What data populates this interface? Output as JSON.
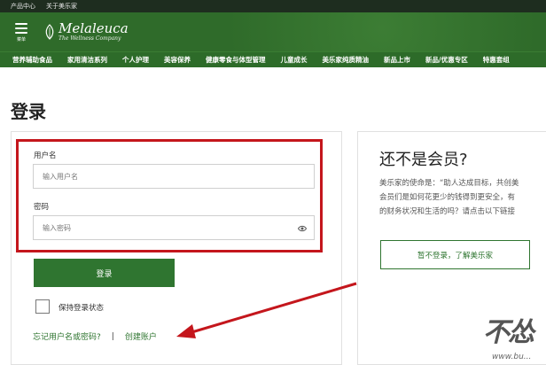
{
  "topbar": {
    "items": [
      "产品中心",
      "关于美乐家"
    ]
  },
  "header": {
    "menu_label": "菜单",
    "brand_name": "Melaleuca",
    "brand_tagline": "The Wellness Company"
  },
  "nav": {
    "items": [
      "营养辅助食品",
      "家用清洁系列",
      "个人护理",
      "美容保养",
      "健康零食与体型管理",
      "儿童成长",
      "美乐家纯质精油",
      "新品上市",
      "新品/优惠专区",
      "特惠套组"
    ]
  },
  "login": {
    "title": "登录",
    "username_label": "用户名",
    "username_placeholder": "输入用户名",
    "password_label": "密码",
    "password_placeholder": "输入密码",
    "submit_label": "登录",
    "remember_label": "保持登录状态",
    "forgot_link": "忘记用户名或密码?",
    "separator": "|",
    "create_link": "创建账户"
  },
  "member": {
    "title": "还不是会员?",
    "text_lines": [
      "美乐家的使命是：“助人达成目标，共创美",
      "会员们是如何花更少的钱得到更安全，有",
      "的财务状况和生活的吗？请点击以下链接"
    ],
    "button_label": "暂不登录，了解美乐家"
  },
  "watermark": {
    "text": "不怂",
    "subtext": "www.bu..."
  },
  "colors": {
    "brand_green": "#2f6b2a",
    "button_green": "#2f7530",
    "highlight_red": "#c4161c"
  }
}
